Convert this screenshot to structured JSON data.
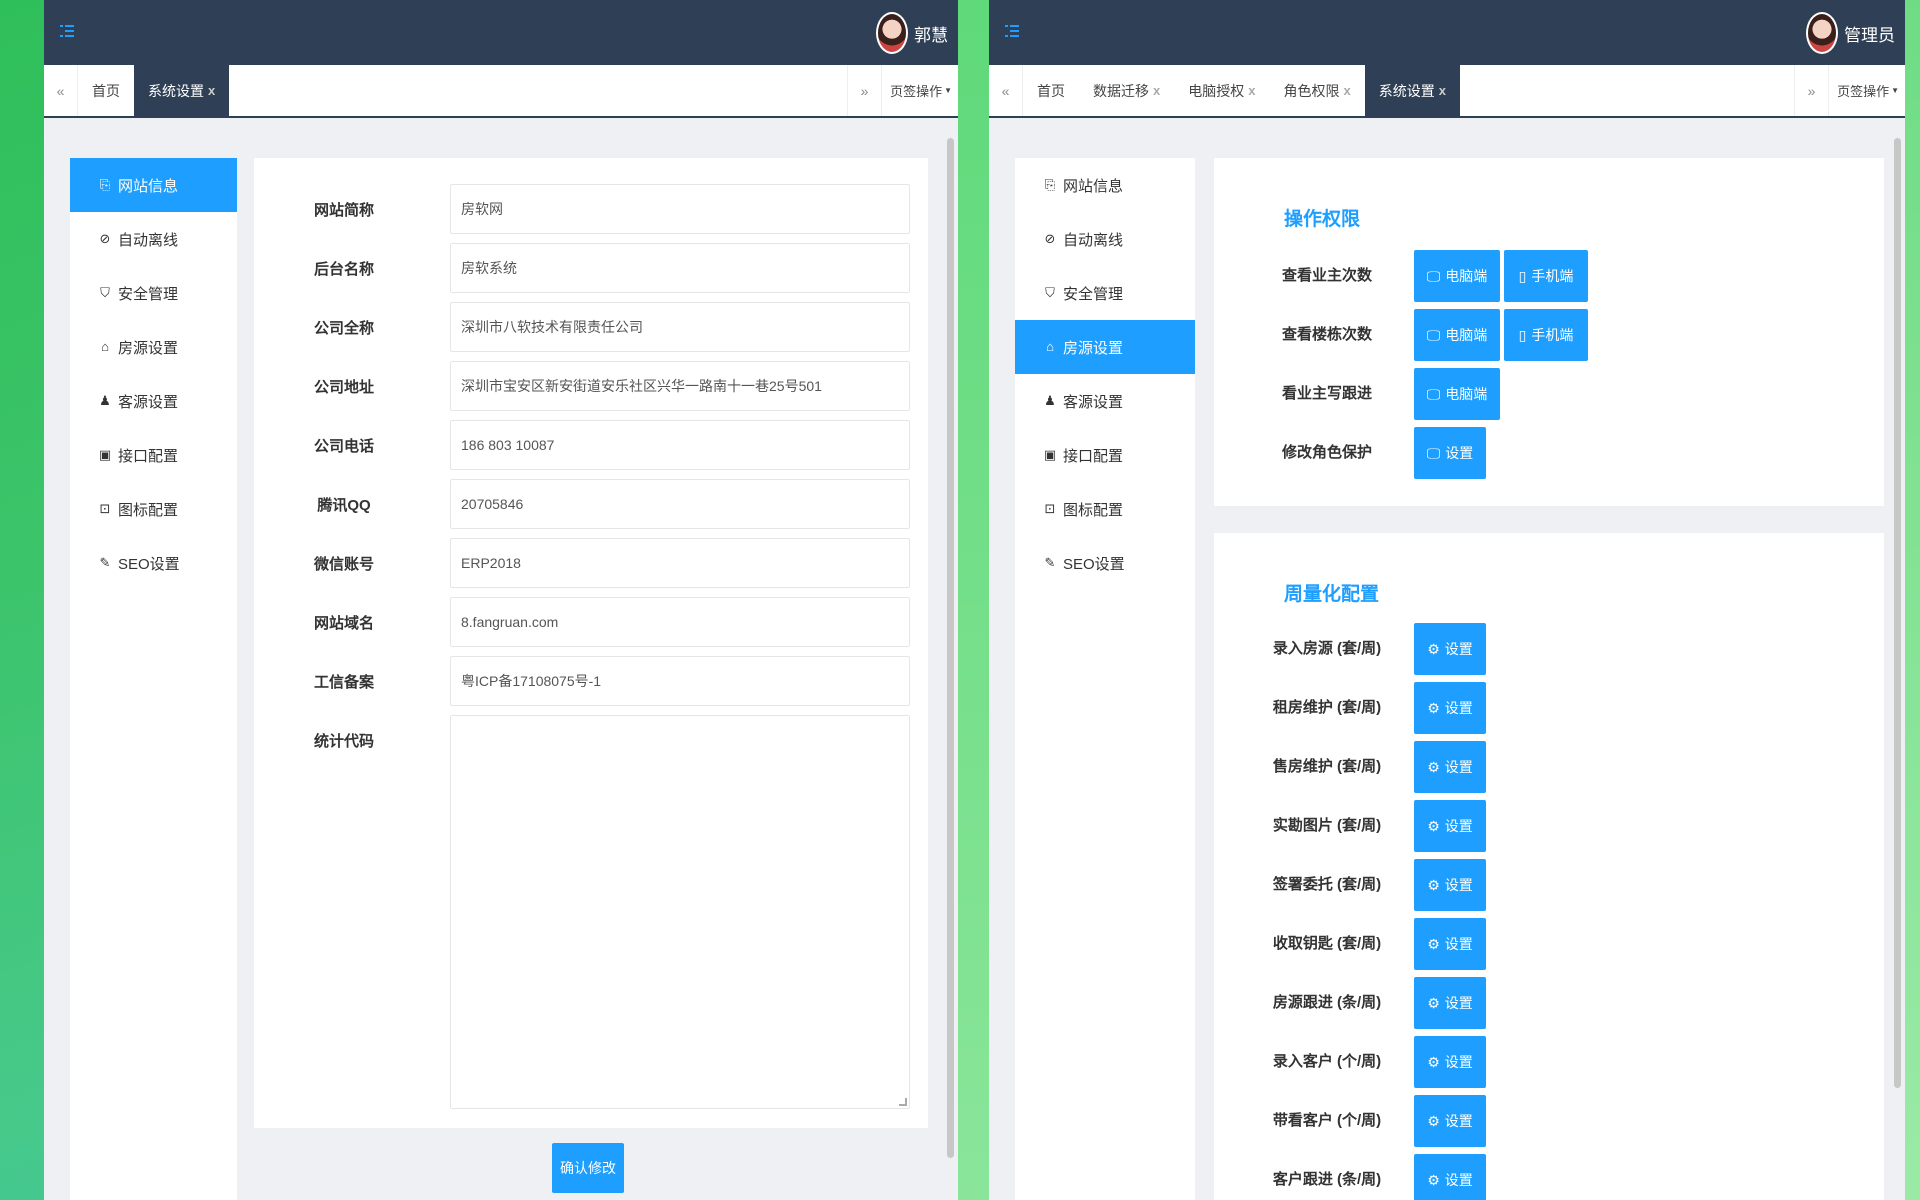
{
  "left": {
    "user": "郭慧",
    "tabs": [
      {
        "label": "首页"
      },
      {
        "label": "系统设置",
        "active": true
      }
    ],
    "tab_ops": "页签操作",
    "nav": [
      {
        "label": "网站信息",
        "icon": "doc-icon",
        "active": true
      },
      {
        "label": "自动离线",
        "icon": "ban-icon"
      },
      {
        "label": "安全管理",
        "icon": "shield-icon"
      },
      {
        "label": "房源设置",
        "icon": "home-icon"
      },
      {
        "label": "客源设置",
        "icon": "user-icon"
      },
      {
        "label": "接口配置",
        "icon": "api-icon"
      },
      {
        "label": "图标配置",
        "icon": "image-icon"
      },
      {
        "label": "SEO设置",
        "icon": "seo-icon"
      }
    ],
    "form": [
      {
        "label": "网站简称",
        "value": "房软网"
      },
      {
        "label": "后台名称",
        "value": "房软系统"
      },
      {
        "label": "公司全称",
        "value": "深圳市八软技术有限责任公司"
      },
      {
        "label": "公司地址",
        "value": "深圳市宝安区新安街道安乐社区兴华一路南十一巷25号501"
      },
      {
        "label": "公司电话",
        "value": "186 803 10087"
      },
      {
        "label": "腾讯QQ",
        "value": "20705846"
      },
      {
        "label": "微信账号",
        "value": "ERP2018"
      },
      {
        "label": "网站域名",
        "value": "8.fangruan.com"
      },
      {
        "label": "工信备案",
        "value": "粤ICP备17108075号-1"
      }
    ],
    "stats_label": "统计代码",
    "submit": "确认修改"
  },
  "right": {
    "user": "管理员",
    "tabs": [
      {
        "label": "首页"
      },
      {
        "label": "数据迁移",
        "closable": true
      },
      {
        "label": "电脑授权",
        "closable": true
      },
      {
        "label": "角色权限",
        "closable": true
      },
      {
        "label": "系统设置",
        "active": true,
        "closable": true
      }
    ],
    "tab_ops": "页签操作",
    "nav": [
      {
        "label": "网站信息",
        "icon": "doc-icon"
      },
      {
        "label": "自动离线",
        "icon": "ban-icon"
      },
      {
        "label": "安全管理",
        "icon": "shield-icon"
      },
      {
        "label": "房源设置",
        "icon": "home-icon",
        "active": true
      },
      {
        "label": "客源设置",
        "icon": "user-icon"
      },
      {
        "label": "接口配置",
        "icon": "api-icon"
      },
      {
        "label": "图标配置",
        "icon": "image-icon"
      },
      {
        "label": "SEO设置",
        "icon": "seo-icon"
      }
    ],
    "perm_title": "操作权限",
    "perms": [
      {
        "label": "查看业主次数",
        "buttons": [
          "电脑端",
          "手机端"
        ]
      },
      {
        "label": "查看楼栋次数",
        "buttons": [
          "电脑端",
          "手机端"
        ]
      },
      {
        "label": "看业主写跟进",
        "buttons": [
          "电脑端"
        ]
      },
      {
        "label": "修改角色保护",
        "buttons": [
          "设置"
        ]
      }
    ],
    "weekly_title": "周量化配置",
    "weekly": [
      "录入房源 (套/周)",
      "租房维护 (套/周)",
      "售房维护 (套/周)",
      "实勘图片 (套/周)",
      "签署委托 (套/周)",
      "收取钥匙 (套/周)",
      "房源跟进 (条/周)",
      "录入客户 (个/周)",
      "带看客户 (个/周)",
      "客户跟进 (条/周)"
    ],
    "set_label": "设置"
  },
  "colors": {
    "topbar": "#2f4056",
    "accent": "#1e9fff"
  }
}
